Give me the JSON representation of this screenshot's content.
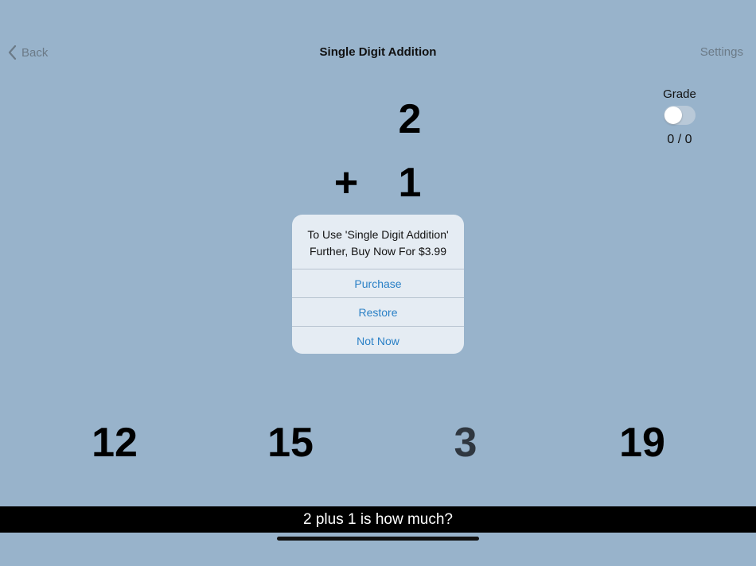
{
  "nav": {
    "back_label": "Back",
    "title": "Single Digit Addition",
    "settings_label": "Settings"
  },
  "grade": {
    "label": "Grade",
    "toggle_on": false,
    "score": "0 / 0"
  },
  "problem": {
    "top": "2",
    "operator": "+",
    "bottom": "1"
  },
  "dialog": {
    "message_line1": "To Use 'Single Digit Addition'",
    "message_line2": "Further, Buy Now For $3.99",
    "buttons": [
      {
        "label": "Purchase"
      },
      {
        "label": "Restore"
      },
      {
        "label": "Not Now"
      }
    ]
  },
  "answers": [
    {
      "value": "12"
    },
    {
      "value": "15"
    },
    {
      "value": "3"
    },
    {
      "value": "19"
    }
  ],
  "caption": "2 plus 1 is how much?",
  "colors": {
    "background": "#98b3cb",
    "accent": "#2a80c6",
    "nav_text": "#6b7a87"
  }
}
